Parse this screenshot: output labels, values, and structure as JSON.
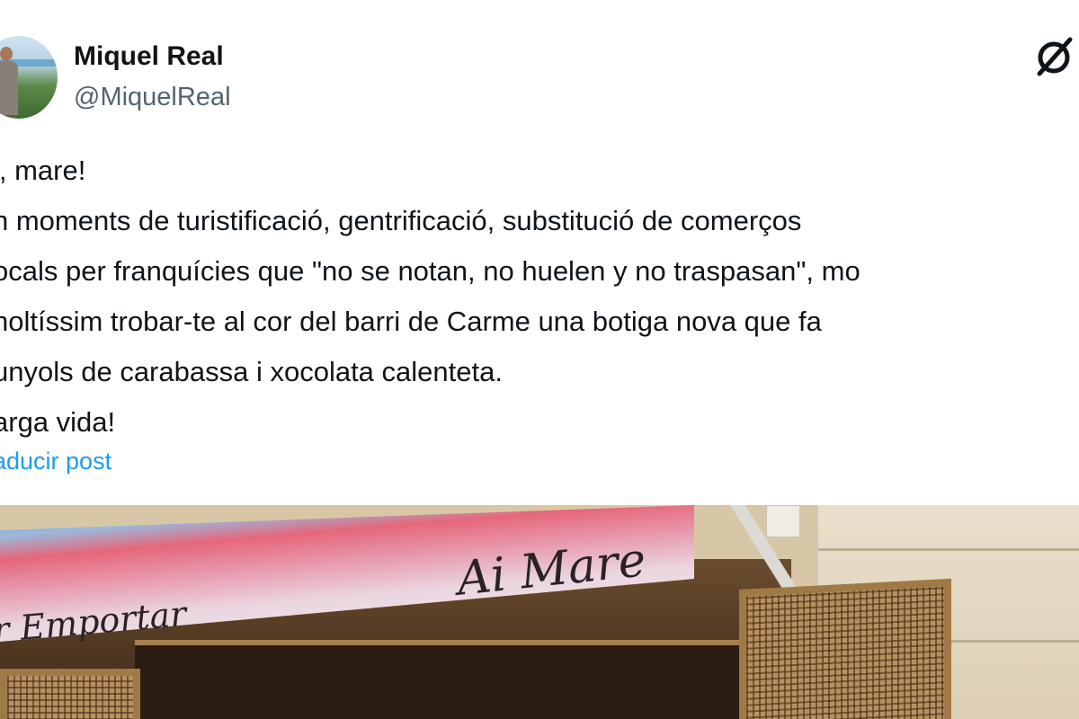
{
  "author": {
    "name": "Miquel Real",
    "handle": "@MiquelReal"
  },
  "tweet": {
    "lines": [
      "i, mare!",
      "n moments de turistificació, gentrificació, substitució de comerços",
      "ocals per franquícies que \"no se notan, no huelen y no traspasan\", mo",
      "noltíssim trobar-te al cor del barri de Carme una botiga nova que fa",
      "unyols de carabassa i xocolata calenteta.",
      "arga vida!"
    ],
    "translate_label": "aducir post"
  },
  "image": {
    "awning_main": "Ai Mare",
    "awning_sub": "r Emportar"
  },
  "colors": {
    "link": "#1d9bf0",
    "handle": "#536471",
    "text": "#0f1419"
  },
  "icons": {
    "brand": "x-logo-icon"
  }
}
